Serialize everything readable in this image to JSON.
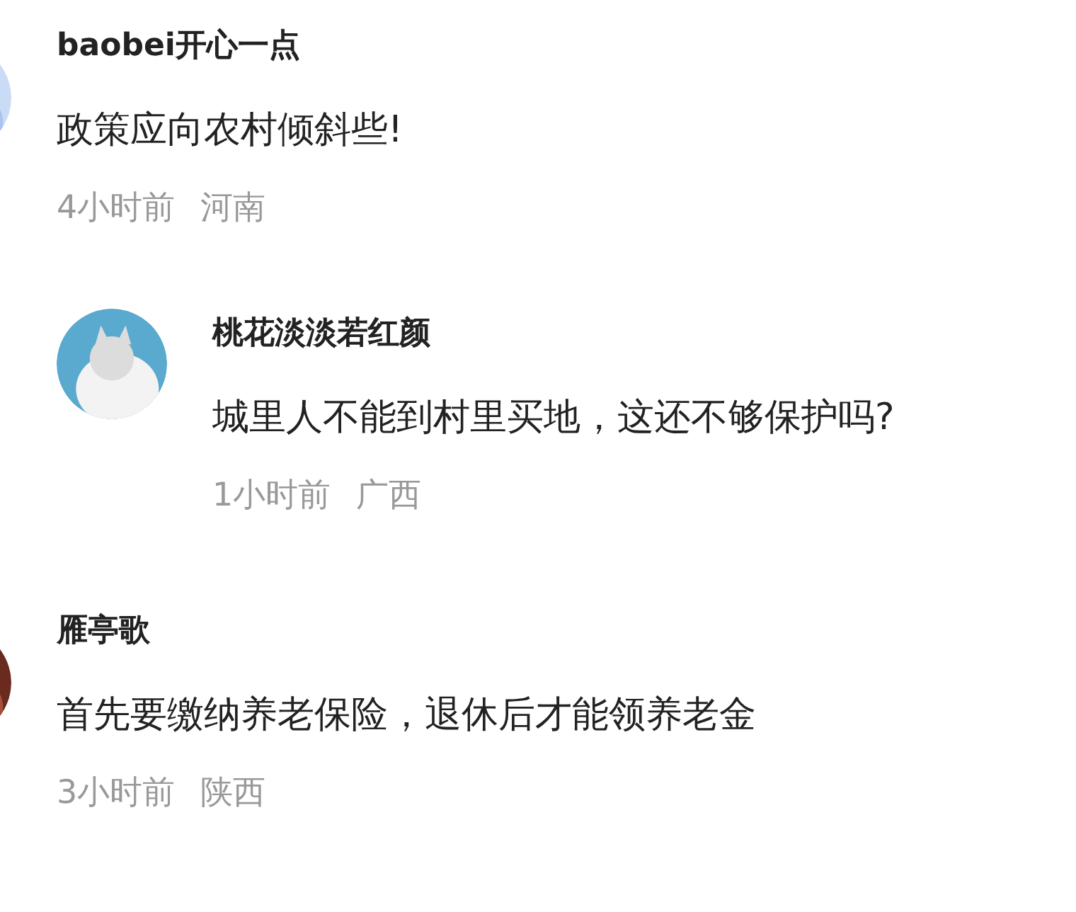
{
  "comments": [
    {
      "name": "baobei开心一点",
      "text": "政策应向农村倾斜些!",
      "time": "4小时前",
      "location": "河南",
      "avatar": {
        "kind": "picture"
      },
      "children": [
        {
          "name": "桃花淡淡若红颜",
          "text": "城里人不能到村里买地，这还不够保护吗?",
          "time": "1小时前",
          "location": "广西",
          "avatar": {
            "kind": "picture"
          }
        }
      ]
    },
    {
      "name": "雁亭歌",
      "text": "首先要缴纳养老保险，退休后才能领养老金",
      "time": "3小时前",
      "location": "陕西",
      "avatar": {
        "kind": "picture"
      }
    }
  ]
}
